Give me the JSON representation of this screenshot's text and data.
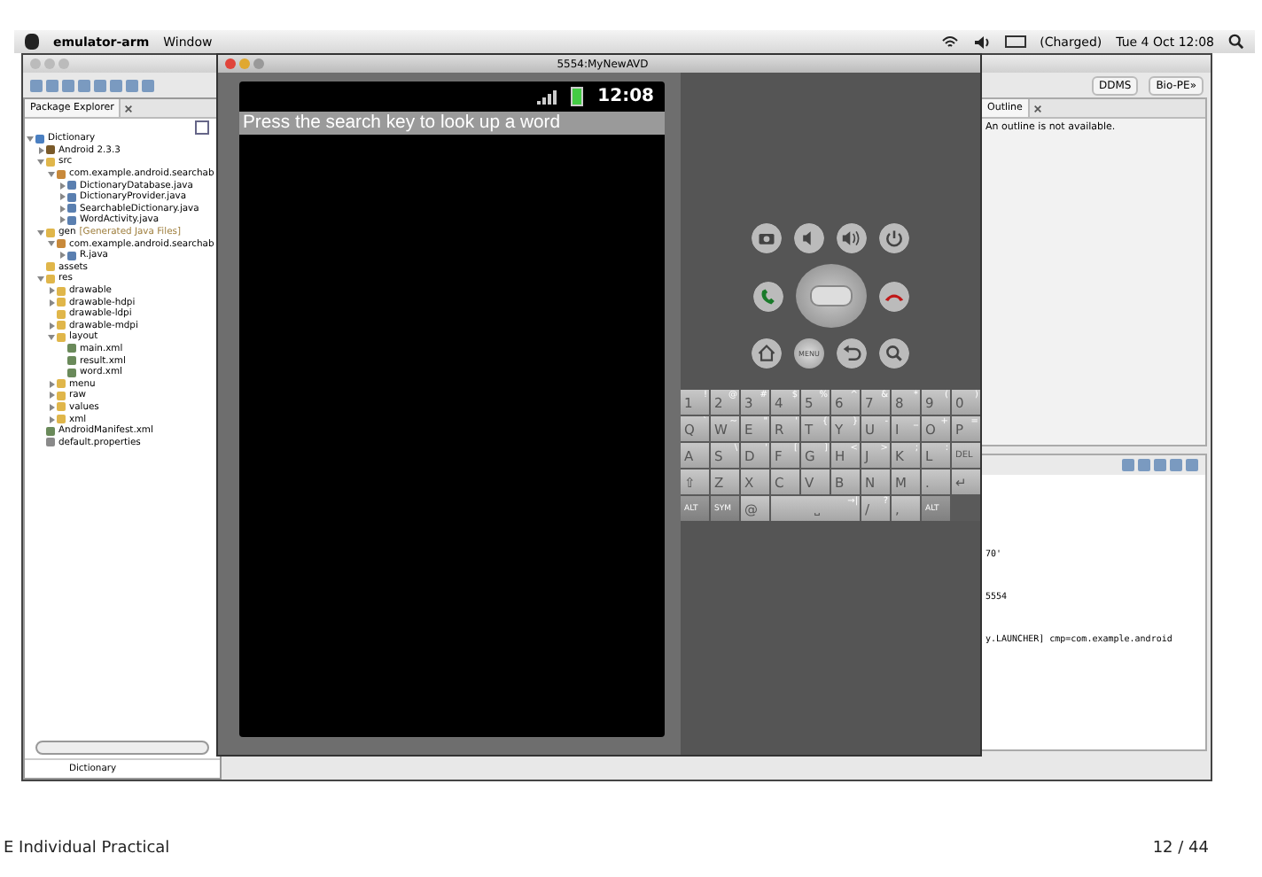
{
  "menu_bar": {
    "app_name": "emulator-arm",
    "menus": [
      "Window"
    ],
    "status": "(Charged)",
    "clock": "Tue 4 Oct  12:08"
  },
  "eclipse": {
    "perspectives": [
      "DDMS",
      "Bio-PE»"
    ],
    "package_explorer": {
      "tab": "Package Explorer",
      "tree": [
        {
          "label": "Dictionary",
          "kind": "project",
          "expanded": true,
          "children": [
            {
              "label": "Android 2.3.3",
              "kind": "library",
              "expanded": false
            },
            {
              "label": "src",
              "kind": "folder",
              "expanded": true,
              "children": [
                {
                  "label": "com.example.android.searchab",
                  "kind": "package",
                  "expanded": true,
                  "children": [
                    {
                      "label": "DictionaryDatabase.java",
                      "kind": "java",
                      "expanded": false
                    },
                    {
                      "label": "DictionaryProvider.java",
                      "kind": "java",
                      "expanded": false
                    },
                    {
                      "label": "SearchableDictionary.java",
                      "kind": "java",
                      "expanded": false
                    },
                    {
                      "label": "WordActivity.java",
                      "kind": "java",
                      "expanded": false
                    }
                  ]
                }
              ]
            },
            {
              "label": "gen",
              "note": "[Generated Java Files]",
              "kind": "folder",
              "expanded": true,
              "children": [
                {
                  "label": "com.example.android.searchab",
                  "kind": "package",
                  "expanded": true,
                  "children": [
                    {
                      "label": "R.java",
                      "kind": "java",
                      "expanded": false
                    }
                  ]
                }
              ]
            },
            {
              "label": "assets",
              "kind": "folder"
            },
            {
              "label": "res",
              "kind": "folder",
              "expanded": true,
              "children": [
                {
                  "label": "drawable",
                  "kind": "folder",
                  "expanded": false
                },
                {
                  "label": "drawable-hdpi",
                  "kind": "folder",
                  "expanded": false
                },
                {
                  "label": "drawable-ldpi",
                  "kind": "folder"
                },
                {
                  "label": "drawable-mdpi",
                  "kind": "folder",
                  "expanded": false
                },
                {
                  "label": "layout",
                  "kind": "folder",
                  "expanded": true,
                  "children": [
                    {
                      "label": "main.xml",
                      "kind": "xml"
                    },
                    {
                      "label": "result.xml",
                      "kind": "xml"
                    },
                    {
                      "label": "word.xml",
                      "kind": "xml"
                    }
                  ]
                },
                {
                  "label": "menu",
                  "kind": "folder",
                  "expanded": false
                },
                {
                  "label": "raw",
                  "kind": "folder",
                  "expanded": false
                },
                {
                  "label": "values",
                  "kind": "folder",
                  "expanded": false
                },
                {
                  "label": "xml",
                  "kind": "folder",
                  "expanded": false
                }
              ]
            },
            {
              "label": "AndroidManifest.xml",
              "kind": "xml"
            },
            {
              "label": "default.properties",
              "kind": "file"
            }
          ]
        }
      ],
      "status": "Dictionary"
    },
    "outline": {
      "tab": "Outline",
      "message": "An outline is not available."
    },
    "console_lines": [
      "70'",
      "5554",
      "y.LAUNCHER] cmp=com.example.android"
    ]
  },
  "emulator": {
    "title": "5554:MyNewAVD",
    "status_time": "12:08",
    "search_hint": "Press the search key to look up a word",
    "menu_label": "MENU",
    "keyboard": [
      [
        {
          "main": "1",
          "alt": "!"
        },
        {
          "main": "2",
          "alt": "@"
        },
        {
          "main": "3",
          "alt": "#"
        },
        {
          "main": "4",
          "alt": "$"
        },
        {
          "main": "5",
          "alt": "%"
        },
        {
          "main": "6",
          "alt": "^"
        },
        {
          "main": "7",
          "alt": "&"
        },
        {
          "main": "8",
          "alt": "*"
        },
        {
          "main": "9",
          "alt": "("
        },
        {
          "main": "0",
          "alt": ")"
        }
      ],
      [
        {
          "main": "Q",
          "alt": "`"
        },
        {
          "main": "W",
          "alt": "~"
        },
        {
          "main": "E",
          "alt": "\""
        },
        {
          "main": "R",
          "alt": "'"
        },
        {
          "main": "T",
          "alt": "{"
        },
        {
          "main": "Y",
          "alt": "}"
        },
        {
          "main": "U",
          "alt": "-"
        },
        {
          "main": "I",
          "alt": "_"
        },
        {
          "main": "O",
          "alt": "+"
        },
        {
          "main": "P",
          "alt": "="
        }
      ],
      [
        {
          "main": "A"
        },
        {
          "main": "S",
          "alt": "\\"
        },
        {
          "main": "D",
          "alt": "'"
        },
        {
          "main": "F",
          "alt": "["
        },
        {
          "main": "G",
          "alt": "]"
        },
        {
          "main": "H",
          "alt": "<"
        },
        {
          "main": "J",
          "alt": ">"
        },
        {
          "main": "K",
          "alt": ";"
        },
        {
          "main": "L",
          "alt": ":"
        },
        {
          "main": "DEL",
          "kind": "del"
        }
      ],
      [
        {
          "main": "⇧",
          "kind": "shift"
        },
        {
          "main": "Z"
        },
        {
          "main": "X"
        },
        {
          "main": "C"
        },
        {
          "main": "V"
        },
        {
          "main": "B"
        },
        {
          "main": "N"
        },
        {
          "main": "M"
        },
        {
          "main": "."
        },
        {
          "main": "↵",
          "kind": "enter"
        }
      ],
      [
        {
          "main": "ALT",
          "kind": "small"
        },
        {
          "main": "SYM",
          "kind": "small"
        },
        {
          "main": "@"
        },
        {
          "main": "⎵",
          "alt": "→|",
          "kind": "space"
        },
        {
          "main": "/",
          "alt": "?"
        },
        {
          "main": ","
        },
        {
          "main": "ALT",
          "kind": "small"
        }
      ]
    ]
  },
  "footer": {
    "left": "E Individual Practical",
    "right": "12 / 44"
  }
}
